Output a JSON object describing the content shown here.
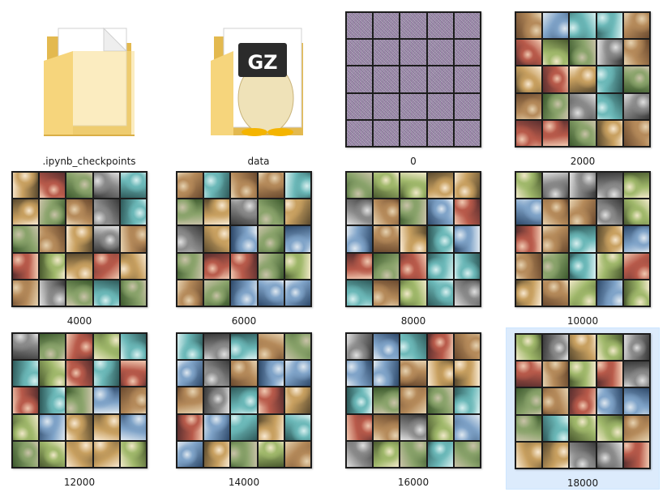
{
  "items": [
    {
      "label": ".ipynb_checkpoints",
      "icon": "folder-icon"
    },
    {
      "label": "data",
      "icon": "gz-archive-folder-icon",
      "badge": "GZ"
    },
    {
      "label": "0"
    },
    {
      "label": "2000"
    },
    {
      "label": "4000"
    },
    {
      "label": "6000"
    },
    {
      "label": "8000"
    },
    {
      "label": "10000"
    },
    {
      "label": "12000"
    },
    {
      "label": "14000"
    },
    {
      "label": "16000"
    },
    {
      "label": "18000",
      "selected": true
    }
  ],
  "colors": {
    "folder_back": "#e8c263",
    "folder_front": "#f7d883",
    "selection_bg": "#dcebfc"
  }
}
